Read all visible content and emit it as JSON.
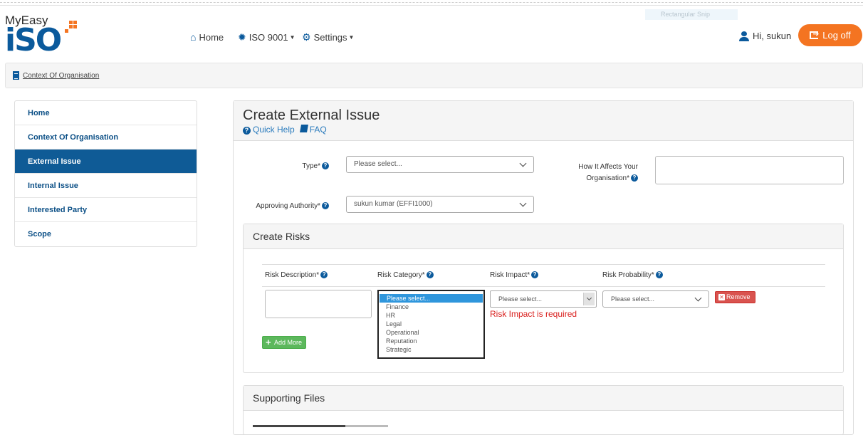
{
  "snip": {
    "label": "Rectangular Snip"
  },
  "logo": {
    "top": "MyEasy",
    "main": "iSO"
  },
  "nav": {
    "home": "Home",
    "iso": "ISO 9001",
    "settings": "Settings"
  },
  "user": {
    "greeting": "Hi, sukun",
    "logoff": "Log off"
  },
  "breadcrumb": {
    "label": "Context Of Organisation"
  },
  "sidebar": {
    "items": [
      {
        "label": "Home"
      },
      {
        "label": "Context Of Organisation"
      },
      {
        "label": "External Issue"
      },
      {
        "label": "Internal Issue"
      },
      {
        "label": "Interested Party"
      },
      {
        "label": "Scope"
      }
    ]
  },
  "main": {
    "title": "Create External Issue",
    "quick_help": "Quick Help",
    "faq": "FAQ",
    "type_label": "Type*",
    "type_value": "Please select...",
    "affects_label_1": "How It Affects Your",
    "affects_label_2": "Organisation*",
    "authority_label": "Approving Authority*",
    "authority_value": "sukun kumar (EFFI1000)"
  },
  "risks": {
    "title": "Create Risks",
    "headers": {
      "description": "Risk Description*",
      "category": "Risk Category*",
      "impact": "Risk Impact*",
      "probability": "Risk Probability*"
    },
    "category_options": [
      "Please select...",
      "Finance",
      "HR",
      "Legal",
      "Operational",
      "Reputation",
      "Strategic"
    ],
    "impact_value": "Please select...",
    "impact_error": "Risk Impact is required",
    "probability_value": "Please select...",
    "remove": "Remove",
    "add_more": "Add More"
  },
  "files": {
    "title": "Supporting Files"
  },
  "colors": {
    "brand": "#0b5a9c",
    "accent": "#f47421",
    "danger": "#d9534f",
    "success": "#5cb85c"
  }
}
